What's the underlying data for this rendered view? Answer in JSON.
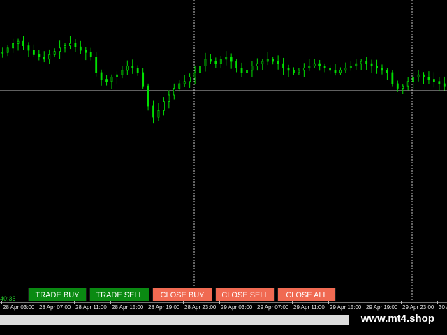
{
  "buttons": {
    "trade_buy": "TRADE BUY",
    "trade_sell": "TRADE SELL",
    "close_buy": "CLOSE BUY",
    "close_sell": "CLOSE SELL",
    "close_all": "CLOSE ALL"
  },
  "timer_text": "40:35",
  "watermark": "www.mt4.shop",
  "colors": {
    "background": "#000000",
    "candle": "#00e000",
    "price_line": "#c0c0c0",
    "separator": "#c8c8c8",
    "buy_button": "#0a8a12",
    "close_button": "#f06a52"
  },
  "chart_data": {
    "type": "candlestick",
    "price_line_level": 0.5,
    "time_labels": [
      "28 Apr 03:00",
      "28 Apr 07:00",
      "28 Apr 11:00",
      "28 Apr 15:00",
      "28 Apr 19:00",
      "28 Apr 23:00",
      "29 Apr 03:00",
      "29 Apr 07:00",
      "29 Apr 11:00",
      "29 Apr 15:00",
      "29 Apr 19:00",
      "29 Apr 23:00",
      "30 A"
    ],
    "day_separators": [
      "29 Apr 00:00",
      "30 Apr 00:00"
    ],
    "series": [
      {
        "values": [
          0.78,
          0.82,
          0.86,
          0.88,
          0.84,
          0.8,
          0.76,
          0.74,
          0.72,
          0.76,
          0.79,
          0.82,
          0.84,
          0.86,
          0.83,
          0.8,
          0.78,
          0.74,
          0.6,
          0.54,
          0.52,
          0.56,
          0.58,
          0.62,
          0.66,
          0.64,
          0.6,
          0.48,
          0.3,
          0.2,
          0.26,
          0.34,
          0.4,
          0.46,
          0.5,
          0.52,
          0.56,
          0.6,
          0.66,
          0.72,
          0.7,
          0.68,
          0.72,
          0.74,
          0.7,
          0.64,
          0.6,
          0.62,
          0.66,
          0.68,
          0.7,
          0.72,
          0.7,
          0.68,
          0.64,
          0.62,
          0.6,
          0.62,
          0.64,
          0.66,
          0.68,
          0.66,
          0.64,
          0.62,
          0.6,
          0.62,
          0.64,
          0.66,
          0.68,
          0.7,
          0.68,
          0.66,
          0.64,
          0.62,
          0.6,
          0.5,
          0.46,
          0.48,
          0.52,
          0.56,
          0.58,
          0.56,
          0.54,
          0.52,
          0.5,
          0.48
        ]
      }
    ]
  }
}
